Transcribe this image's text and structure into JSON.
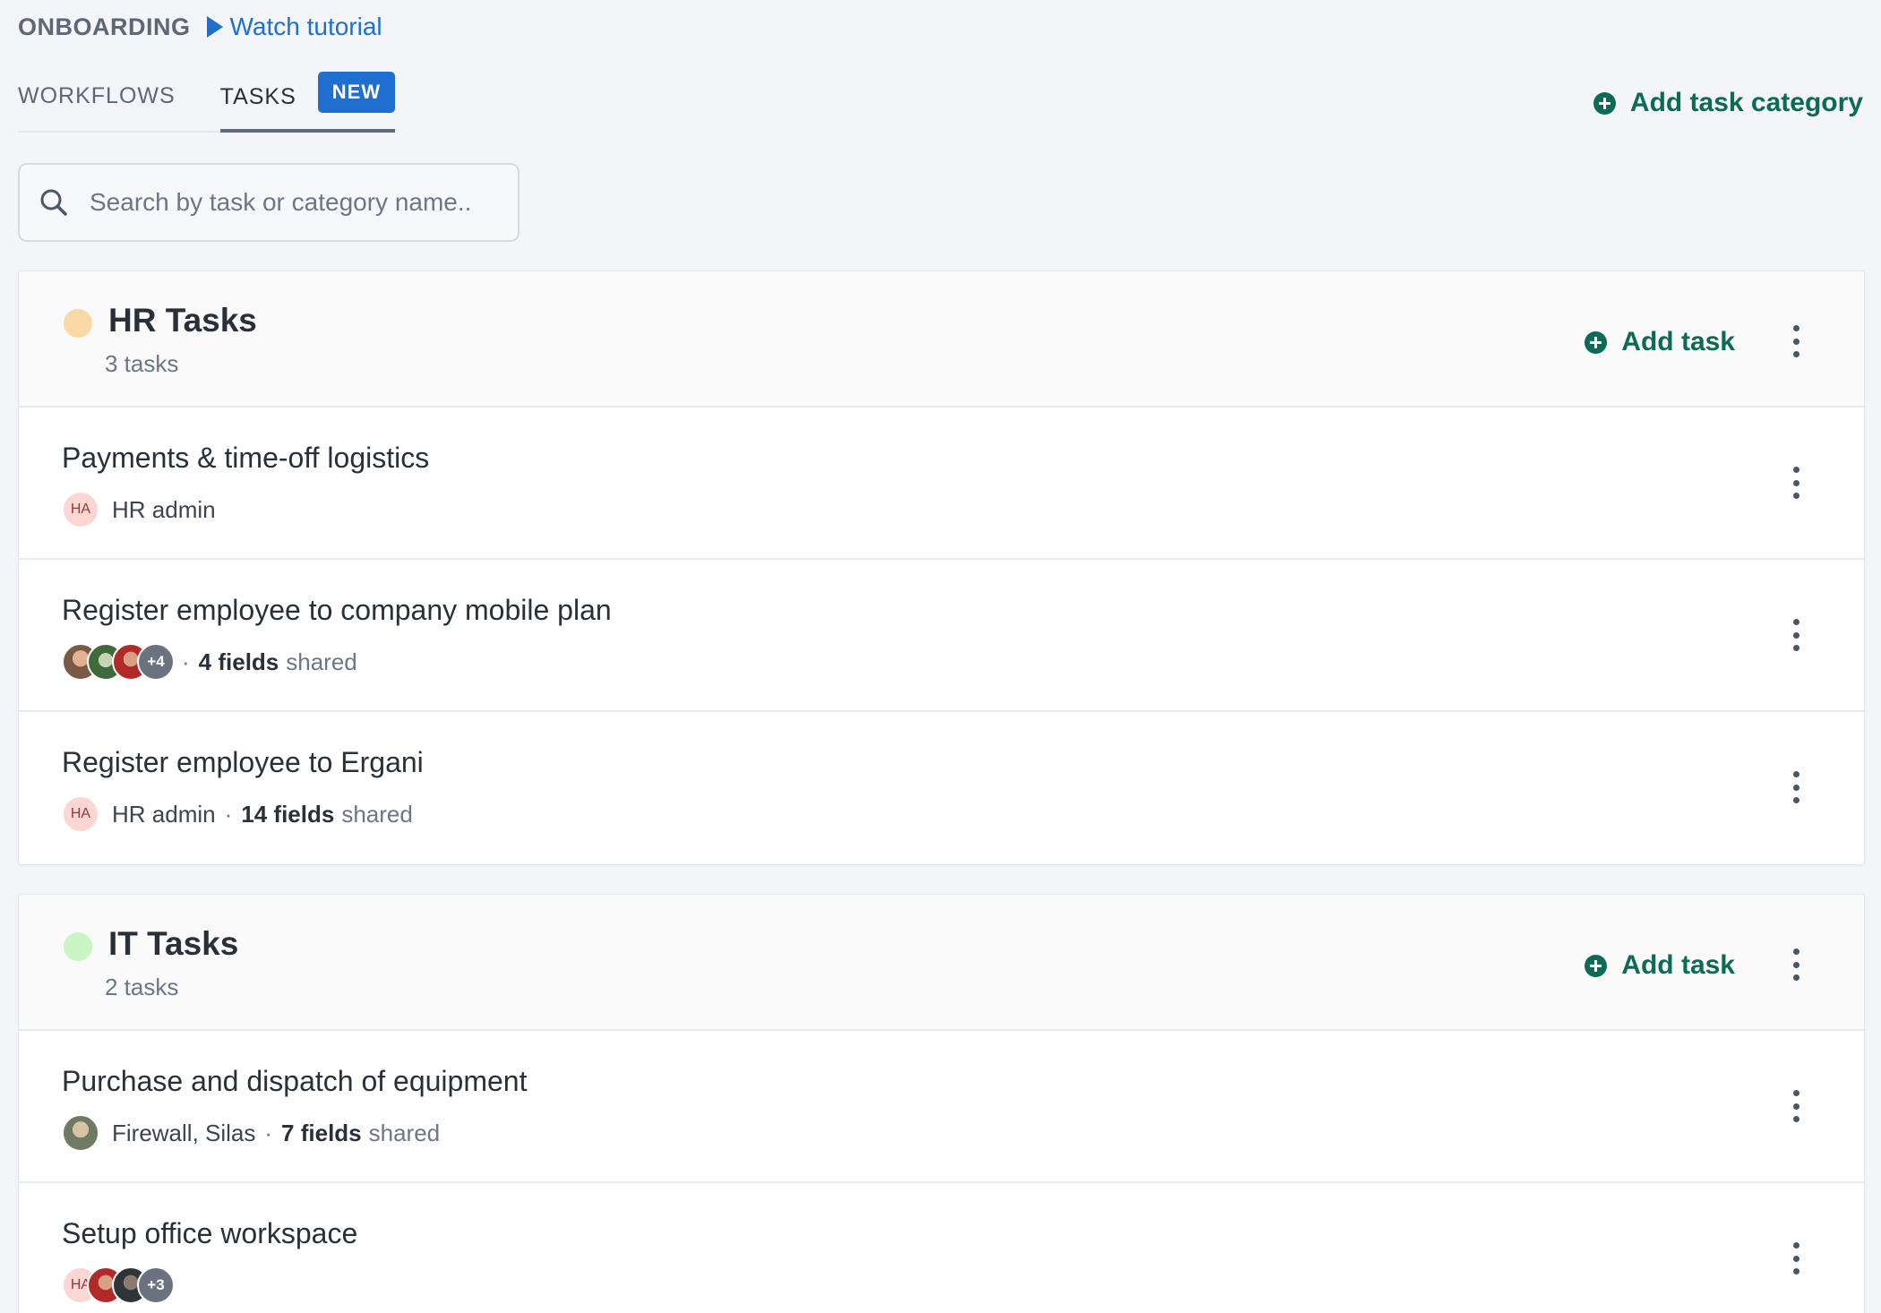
{
  "header": {
    "brand": "ONBOARDING",
    "tutorial_label": "Watch tutorial"
  },
  "tabs": {
    "workflows": "WORKFLOWS",
    "tasks": "TASKS",
    "new_badge": "NEW"
  },
  "add_category_label": "Add task category",
  "search": {
    "placeholder": "Search by task or category name.."
  },
  "colors": {
    "accent_green": "#0c6b55",
    "accent_blue": "#1f6fd1",
    "hr_dot": "#fbd9a6",
    "it_dot": "#c9f5c5"
  },
  "categories": [
    {
      "title": "HR Tasks",
      "count": "3 tasks",
      "add_task_label": "Add task",
      "tasks": [
        {
          "title": "Payments & time-off logistics",
          "assignee_initials": "HA",
          "assignee": "HR admin"
        },
        {
          "title": "Register employee to company mobile plan",
          "more_count": "+4",
          "fields": "4 fields",
          "shared": "shared"
        },
        {
          "title": "Register employee to Ergani",
          "assignee_initials": "HA",
          "assignee": "HR admin",
          "fields": "14 fields",
          "shared": "shared"
        }
      ]
    },
    {
      "title": "IT Tasks",
      "count": "2 tasks",
      "add_task_label": "Add task",
      "tasks": [
        {
          "title": "Purchase and dispatch of equipment",
          "assignee": "Firewall, Silas",
          "fields": "7 fields",
          "shared": "shared"
        },
        {
          "title": "Setup office workspace",
          "assignee_initials": "HA",
          "more_count": "+3"
        }
      ]
    }
  ],
  "separator": "·"
}
